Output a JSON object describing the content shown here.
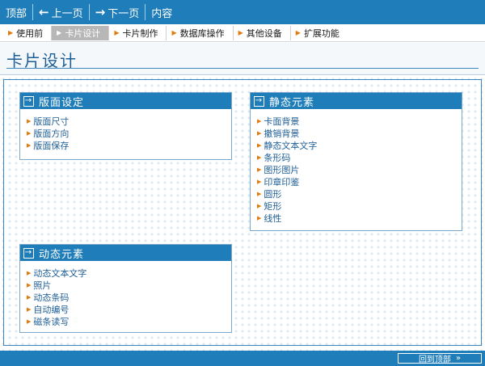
{
  "topbar": {
    "items": [
      {
        "label": "顶部"
      },
      {
        "label": "上一页",
        "arrow": "←"
      },
      {
        "label": "下一页",
        "arrow": "→"
      },
      {
        "label": "内容"
      }
    ]
  },
  "tabs": [
    {
      "label": "使用前"
    },
    {
      "label": "卡片设计",
      "active": true
    },
    {
      "label": "卡片制作"
    },
    {
      "label": "数据库操作"
    },
    {
      "label": "其他设备"
    },
    {
      "label": "扩展功能"
    }
  ],
  "header": {
    "title": "卡片设计"
  },
  "panels": {
    "layout": {
      "title": "版面设定",
      "items": [
        "版面尺寸",
        "版面方向",
        "版面保存"
      ]
    },
    "static": {
      "title": "静态元素",
      "items": [
        "卡面背景",
        "撤销背景",
        "静态文本文字",
        "条形码",
        "图形图片",
        "印章印鉴",
        "圆形",
        "矩形",
        "线性"
      ]
    },
    "dynamic": {
      "title": "动态元素",
      "items": [
        "动态文本文字",
        "照片",
        "动态条码",
        "自动编号",
        "磁条读写"
      ]
    }
  },
  "footer": {
    "back_top": "回到顶部",
    "arrow": "»"
  },
  "colors": {
    "brand": "#1f7db9",
    "accent": "#e07b10"
  }
}
